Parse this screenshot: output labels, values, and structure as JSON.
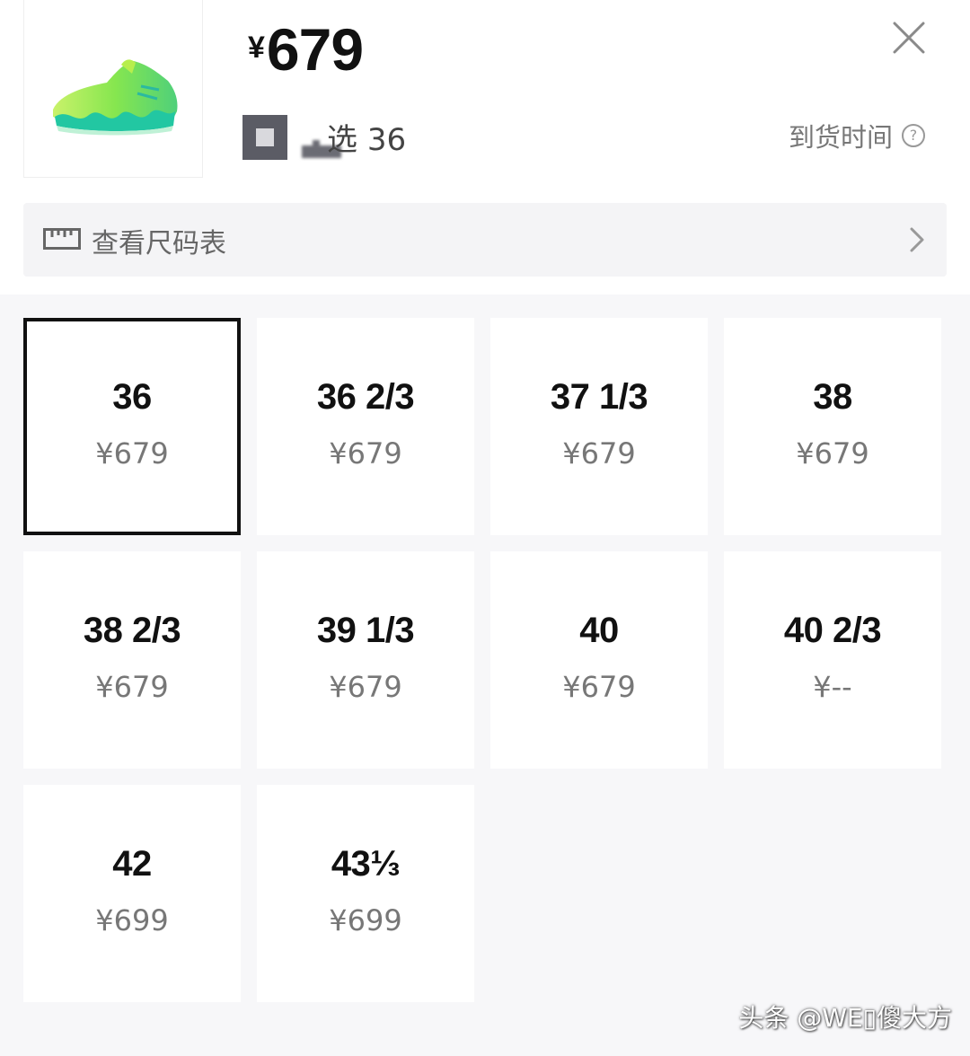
{
  "header": {
    "currency_symbol": "¥",
    "price": "679",
    "selected_prefix": "选",
    "selected_size": "36",
    "arrival_label": "到货时间",
    "help_glyph": "?"
  },
  "size_chart": {
    "label": "查看尺码表"
  },
  "sizes": [
    {
      "size": "36",
      "price": "¥679",
      "selected": true
    },
    {
      "size": "36 2/3",
      "price": "¥679",
      "selected": false
    },
    {
      "size": "37 1/3",
      "price": "¥679",
      "selected": false
    },
    {
      "size": "38",
      "price": "¥679",
      "selected": false
    },
    {
      "size": "38 2/3",
      "price": "¥679",
      "selected": false
    },
    {
      "size": "39 1/3",
      "price": "¥679",
      "selected": false
    },
    {
      "size": "40",
      "price": "¥679",
      "selected": false
    },
    {
      "size": "40 2/3",
      "price": "¥--",
      "selected": false
    },
    {
      "size": "42",
      "price": "¥699",
      "selected": false
    },
    {
      "size": "43⅓",
      "price": "¥699",
      "selected": false
    }
  ],
  "watermark": "头条 @WE▯傻大方",
  "icons": {
    "close": "close-icon",
    "ruler": "ruler-icon",
    "chevron": "chevron-right-icon",
    "help": "help-circle-icon"
  },
  "colors": {
    "selected_border": "#111111",
    "tile_bg": "#ffffff",
    "page_bg": "#f7f7f9",
    "shoe_green": "#7de35a",
    "shoe_teal": "#1fbf9a"
  }
}
